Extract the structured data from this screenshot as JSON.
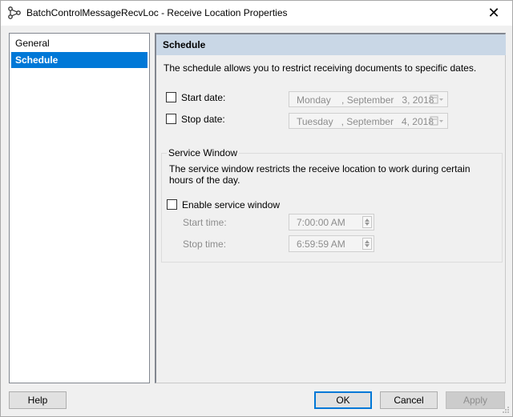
{
  "window": {
    "title": "BatchControlMessageRecvLoc - Receive Location Properties",
    "close_glyph": "✕"
  },
  "nav": {
    "items": [
      {
        "label": "General",
        "selected": false
      },
      {
        "label": "Schedule",
        "selected": true
      }
    ]
  },
  "schedule": {
    "header": "Schedule",
    "description": "The schedule allows you to restrict receiving documents to specific dates.",
    "start_date": {
      "label": "Start date:",
      "checked": false,
      "value": "Monday    , September   3, 2018"
    },
    "stop_date": {
      "label": "Stop date:",
      "checked": false,
      "value": "Tuesday   , September   4, 2018"
    }
  },
  "service_window": {
    "legend": "Service Window",
    "description": "The service window restricts the receive location to work during certain hours of the day.",
    "enable": {
      "label": "Enable service window",
      "checked": false
    },
    "start_time": {
      "label": "Start time:",
      "value": "7:00:00 AM"
    },
    "stop_time": {
      "label": "Stop time:",
      "value": "6:59:59 AM"
    }
  },
  "buttons": {
    "help": "Help",
    "ok": "OK",
    "cancel": "Cancel",
    "apply": "Apply"
  },
  "colors": {
    "accent": "#0078d7",
    "header_band": "#c9d7e6"
  }
}
